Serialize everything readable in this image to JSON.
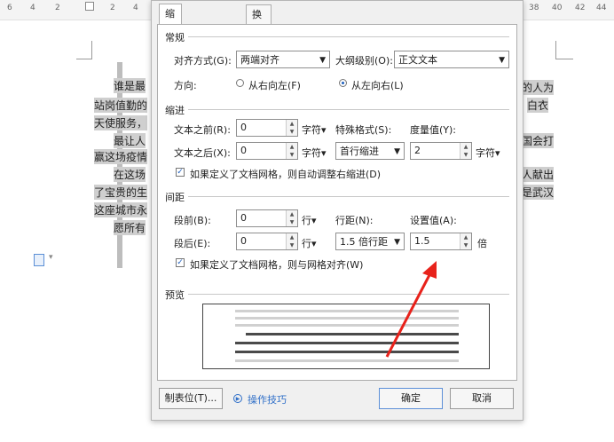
{
  "ruler": {
    "left_numbers": [
      "6",
      "4",
      "2",
      "2",
      "4"
    ],
    "right_numbers": [
      "38",
      "40",
      "42",
      "44"
    ]
  },
  "document": {
    "lines": [
      {
        "text": "谁是最",
        "indent": true
      },
      {
        "text": "站岗值勤的",
        "indent": false
      },
      {
        "text": "天使服务，",
        "indent": false
      },
      {
        "text": "最让人",
        "indent": true
      },
      {
        "text": "赢这场疫情",
        "indent": false
      },
      {
        "text": "在这场",
        "indent": true
      },
      {
        "text": "了宝贵的生",
        "indent": false
      },
      {
        "text": "这座城市永",
        "indent": false
      },
      {
        "text": "愿所有",
        "indent": true
      }
    ],
    "right_fragments": [
      "的人为",
      "白衣",
      "国会打",
      "人献出",
      "是武汉"
    ]
  },
  "dialog": {
    "tabs": [
      {
        "label": "缩进和间距(I)",
        "active": true
      },
      {
        "label": "换行和分页(P)",
        "active": false
      }
    ],
    "general": {
      "title": "常规",
      "alignment_label": "对齐方式(G):",
      "alignment_value": "两端对齐",
      "outline_label": "大纲级别(O):",
      "outline_value": "正文文本",
      "direction_label": "方向:",
      "rtl_label": "从右向左(F)",
      "ltr_label": "从左向右(L)",
      "direction_selected": "ltr"
    },
    "indent": {
      "title": "缩进",
      "before_label": "文本之前(R):",
      "before_value": "0",
      "before_unit": "字符▾",
      "special_label": "特殊格式(S):",
      "measure_label": "度量值(Y):",
      "after_label": "文本之后(X):",
      "after_value": "0",
      "after_unit": "字符▾",
      "special_value": "首行缩进",
      "measure_value": "2",
      "measure_unit": "字符▾",
      "auto_adjust_label": "如果定义了文档网格，则自动调整右缩进(D)",
      "auto_adjust_checked": true
    },
    "spacing": {
      "title": "间距",
      "before_label": "段前(B):",
      "before_value": "0",
      "before_unit": "行▾",
      "line_spacing_label": "行距(N):",
      "setting_label": "设置值(A):",
      "after_label": "段后(E):",
      "after_value": "0",
      "after_unit": "行▾",
      "line_spacing_value": "1.5 倍行距",
      "setting_value": "1.5",
      "setting_unit": "倍",
      "grid_align_label": "如果定义了文档网格，则与网格对齐(W)",
      "grid_align_checked": true
    },
    "preview": {
      "title": "预览"
    },
    "buttons": {
      "tabs_label": "制表位(T)...",
      "tips_label": "操作技巧",
      "ok_label": "确定",
      "cancel_label": "取消"
    }
  },
  "colors": {
    "accent": "#1e5fbf",
    "annotation_arrow": "#e8221b"
  }
}
